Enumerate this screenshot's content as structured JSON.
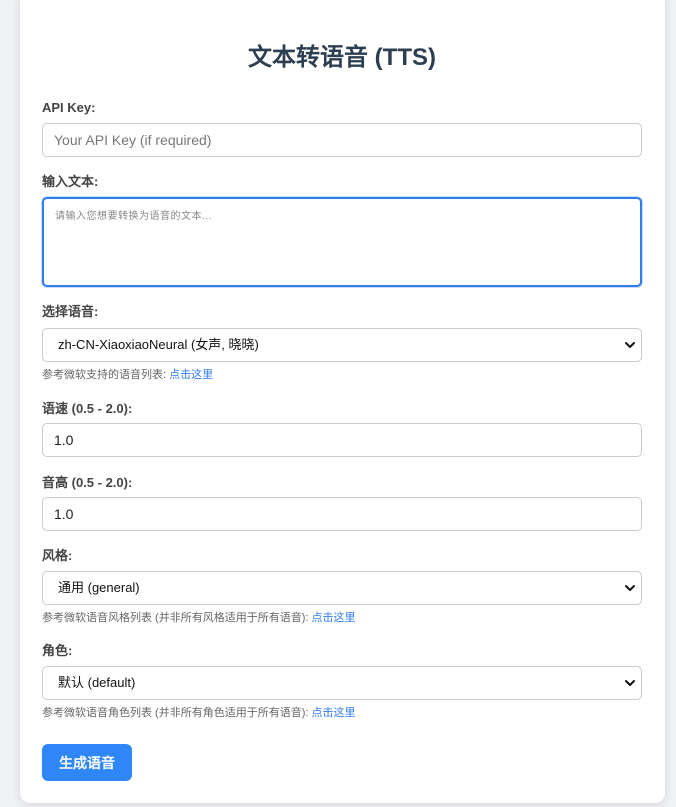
{
  "title": "文本转语音 (TTS)",
  "api_key": {
    "label": "API Key:",
    "placeholder": "Your API Key (if required)",
    "value": ""
  },
  "text_input": {
    "label": "输入文本:",
    "placeholder": "请输入您想要转换为语音的文本...",
    "value": ""
  },
  "voice": {
    "label": "选择语音:",
    "selected": "zh-CN-XiaoxiaoNeural (女声, 晓晓)",
    "help_text": "参考微软支持的语音列表: ",
    "help_link": "点击这里"
  },
  "rate": {
    "label": "语速 (0.5 - 2.0):",
    "value": "1.0"
  },
  "pitch": {
    "label": "音高 (0.5 - 2.0):",
    "value": "1.0"
  },
  "style": {
    "label": "风格:",
    "selected": "通用 (general)",
    "help_text": "参考微软语音风格列表 (并非所有风格适用于所有语音): ",
    "help_link": "点击这里"
  },
  "role": {
    "label": "角色:",
    "selected": "默认 (default)",
    "help_text": "参考微软语音角色列表 (并非所有角色适用于所有语音): ",
    "help_link": "点击这里"
  },
  "generate_button": "生成语音",
  "colors": {
    "accent": "#2f86f6",
    "title": "#2c3e50",
    "link": "#2f7cf0"
  }
}
